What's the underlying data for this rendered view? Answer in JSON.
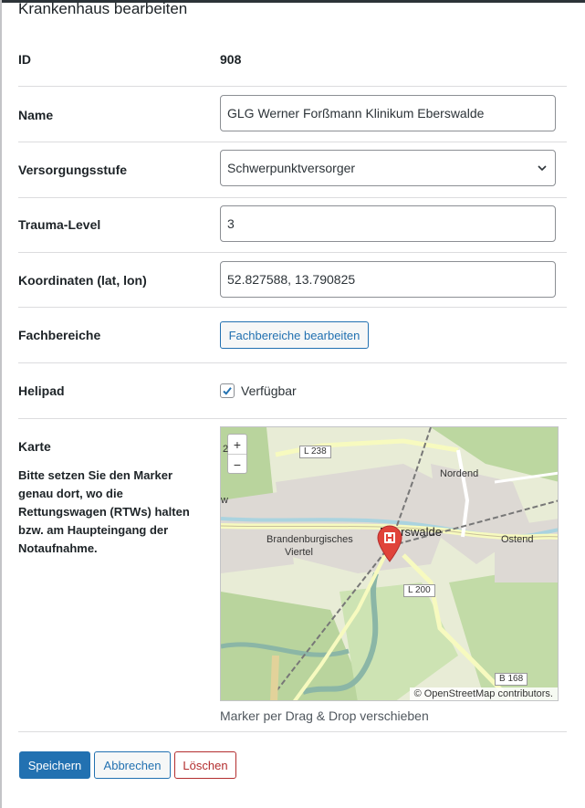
{
  "page": {
    "title": "Krankenhaus bearbeiten"
  },
  "fields": {
    "id": {
      "label": "ID",
      "value": "908"
    },
    "name": {
      "label": "Name",
      "value": "GLG Werner Forßmann Klinikum Eberswalde"
    },
    "level": {
      "label": "Versorgungsstufe",
      "value": "Schwerpunktversorger"
    },
    "trauma": {
      "label": "Trauma-Level",
      "value": "3"
    },
    "coords": {
      "label": "Koordinaten (lat, lon)",
      "value": "52.827588, 13.790825"
    },
    "departments": {
      "label": "Fachbereiche",
      "button": "Fachbereiche bearbeiten"
    },
    "helipad": {
      "label": "Helipad",
      "checkbox_label": "Verfügbar",
      "checked": true
    },
    "map": {
      "label": "Karte",
      "help": "Bitte setzen Sie den Marker genau dort, wo die Rettungswagen (RTWs) halten bzw. am Haupteingang der Notaufnahme.",
      "hint": "Marker per Drag & Drop verschieben",
      "zoom_in": "+",
      "zoom_out": "−",
      "attribution": "© OpenStreetMap contributors.",
      "places": {
        "eberswalde": "Eberswalde",
        "nordend": "Nordend",
        "ostend": "Ostend",
        "brandenburgisches": "Brandenburgisches",
        "viertel": "Viertel",
        "w": "w",
        "two": "2"
      },
      "roads": {
        "l238": "L 238",
        "l200": "L 200",
        "b168": "B 168"
      }
    }
  },
  "actions": {
    "save": "Speichern",
    "cancel": "Abbrechen",
    "delete": "Löschen"
  },
  "colors": {
    "accent": "#2271b1",
    "danger": "#b32d2e",
    "marker": "#e0433a"
  }
}
